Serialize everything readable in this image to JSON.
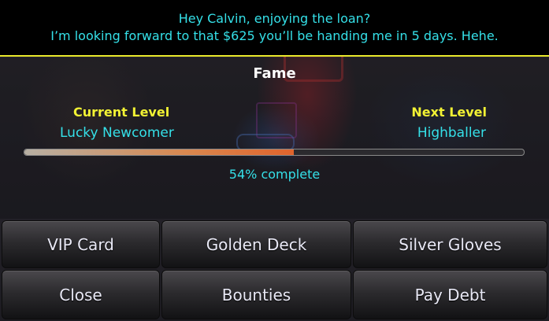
{
  "message": {
    "line1": "Hey Calvin, enjoying the loan?",
    "line2": "I’m looking forward to that $625 you’ll be handing me in 5 days. Hehe."
  },
  "fame": {
    "title": "Fame",
    "current_label": "Current Level",
    "current_value": "Lucky Newcomer",
    "next_label": "Next Level",
    "next_value": "Highballer",
    "progress": 0.54,
    "progress_text": "54% complete"
  },
  "buttons": {
    "vip_card": "VIP Card",
    "golden_deck": "Golden Deck",
    "silver_gloves": "Silver Gloves",
    "close": "Close",
    "bounties": "Bounties",
    "pay_debt": "Pay Debt"
  },
  "colors": {
    "message_text": "#35e0e8",
    "divider": "#e8e82a",
    "label_yellow": "#f2f234",
    "progress_fill": "#e0632c"
  }
}
